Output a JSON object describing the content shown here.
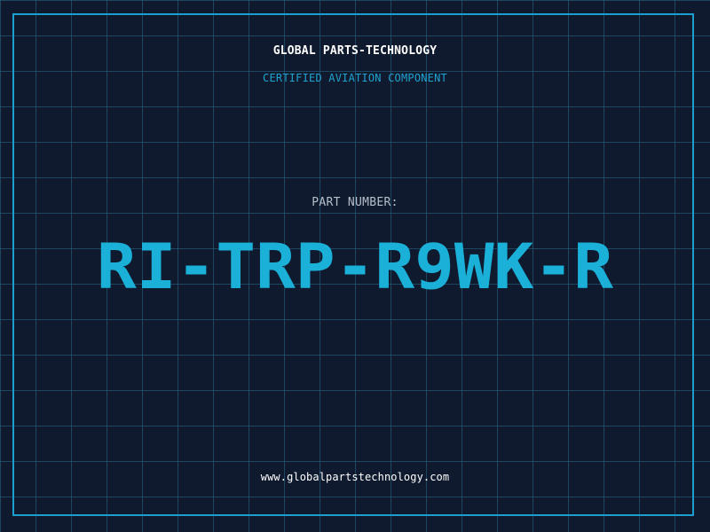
{
  "header": {
    "company": "GLOBAL PARTS-TECHNOLOGY",
    "subtitle": "CERTIFIED AVIATION COMPONENT"
  },
  "part": {
    "label": "PART NUMBER:",
    "number": "RI-TRP-R9WK-R"
  },
  "footer": {
    "website": "www.globalpartstechnology.com"
  },
  "colors": {
    "background": "#0f1a2e",
    "grid": "#2a6a8a",
    "frame": "#1c9fcf",
    "accent": "#1ab0d8",
    "label": "#b7bfca",
    "text": "#ffffff"
  }
}
